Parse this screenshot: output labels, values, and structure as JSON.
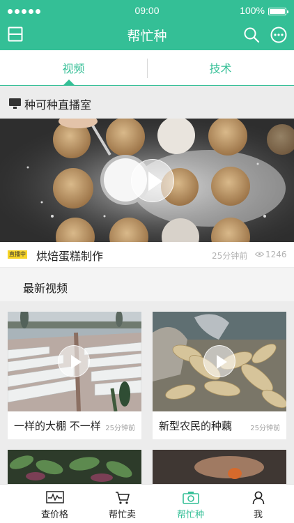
{
  "status_bar": {
    "time": "09:00",
    "battery": "100%"
  },
  "nav": {
    "title": "帮忙种",
    "left_icon": "layout-icon",
    "search_icon": "search-icon",
    "more_icon": "more-icon"
  },
  "tabs": [
    {
      "label": "视频",
      "active": true
    },
    {
      "label": "技术",
      "active": false
    }
  ],
  "live_section": {
    "title": "种可种直播室",
    "badge": "直播中",
    "video_title": "烘焙蛋糕制作",
    "time": "25分钟前",
    "views": "1246"
  },
  "latest_section": {
    "title": "最新视频",
    "videos": [
      {
        "title": "一样的大棚 不一样",
        "time": "25分钟前"
      },
      {
        "title": "新型农民的种藕",
        "time": "25分钟前"
      }
    ]
  },
  "bottom_tabs": [
    {
      "label": "查价格",
      "icon": "price-chart-icon",
      "active": false
    },
    {
      "label": "帮忙卖",
      "icon": "cart-icon",
      "active": false
    },
    {
      "label": "帮忙种",
      "icon": "camera-icon",
      "active": true
    },
    {
      "label": "我",
      "icon": "user-icon",
      "active": false
    }
  ],
  "colors": {
    "accent": "#34bf96",
    "live_badge": "#f7d426"
  }
}
